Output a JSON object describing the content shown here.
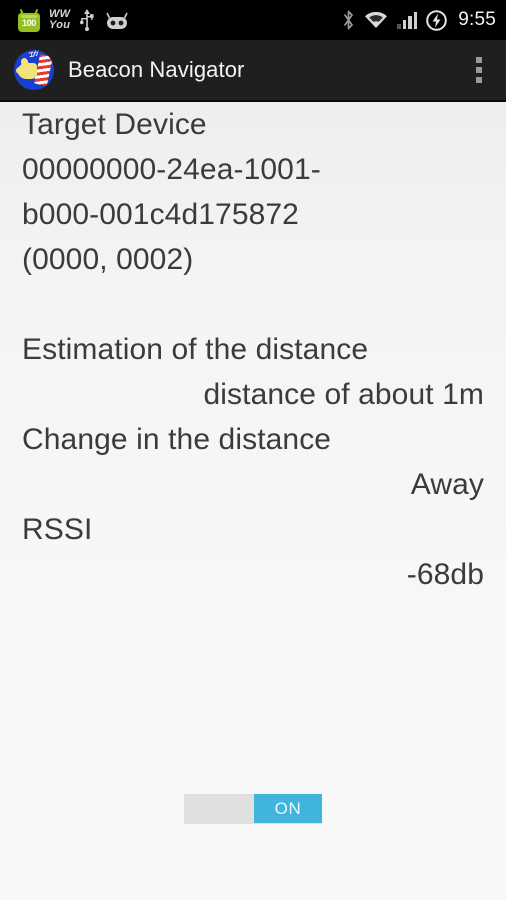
{
  "status_bar": {
    "battery_level": "100",
    "carrier_line1": "WW",
    "carrier_line2": "You",
    "icons": [
      "battery-icon",
      "usb-icon",
      "cyanogenmod-icon",
      "bluetooth-icon",
      "wifi-icon",
      "signal-icon",
      "power-saver-icon"
    ],
    "clock": "9:55"
  },
  "action_bar": {
    "app_icon_name": "beacon-navigator-app-icon",
    "app_icon_kana": "ｺﾝｼﾞ",
    "title": "Beacon Navigator",
    "overflow_label": "overflow-menu"
  },
  "main": {
    "target_device_label": "Target Device",
    "uuid_line1": "00000000-24ea-1001-",
    "uuid_line2": "b000-001c4d175872",
    "major_minor": "(0000, 0002)",
    "estimation_label": "Estimation of the distance",
    "estimation_value": "distance of about 1m",
    "change_label": "Change in the distance",
    "change_value": "Away",
    "rssi_label": "RSSI",
    "rssi_value": "-68db"
  },
  "toggle": {
    "state_label": "ON",
    "checked": true
  },
  "colors": {
    "accent": "#40b4dc",
    "status_bar_bg": "#000000",
    "action_bar_bg": "#1f1f1f",
    "content_bg": "#f5f5f5",
    "text": "#3b3b3b",
    "battery_green": "#93c01f"
  }
}
